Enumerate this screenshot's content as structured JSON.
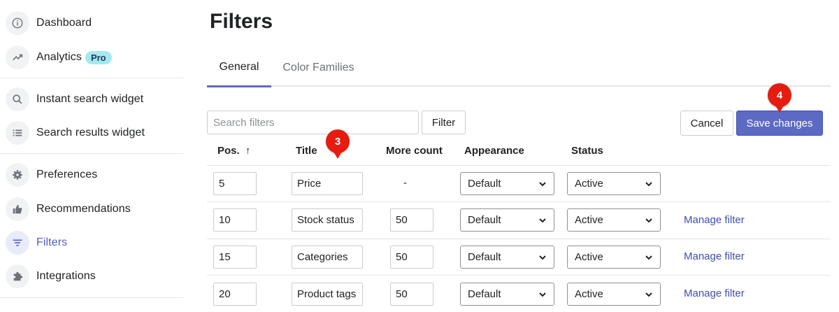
{
  "sidebar": {
    "items": [
      {
        "label": "Dashboard",
        "icon": "info-icon"
      },
      {
        "label": "Analytics",
        "icon": "trend-icon",
        "badge": "Pro"
      },
      {
        "label": "Instant search widget",
        "icon": "search-icon"
      },
      {
        "label": "Search results widget",
        "icon": "list-icon"
      },
      {
        "label": "Preferences",
        "icon": "gear-icon"
      },
      {
        "label": "Recommendations",
        "icon": "thumbs-up-icon"
      },
      {
        "label": "Filters",
        "icon": "filter-icon",
        "active": true
      },
      {
        "label": "Integrations",
        "icon": "puzzle-icon"
      }
    ]
  },
  "page": {
    "title": "Filters",
    "tabs": [
      {
        "label": "General",
        "active": true
      },
      {
        "label": "Color Families",
        "active": false
      }
    ]
  },
  "toolbar": {
    "search_placeholder": "Search filters",
    "filter_label": "Filter",
    "cancel_label": "Cancel",
    "save_label": "Save changes"
  },
  "markers": {
    "title_marker": "3",
    "save_marker": "4"
  },
  "table": {
    "headers": {
      "pos": "Pos.",
      "pos_sort": "↑",
      "title": "Title",
      "more_count": "More count",
      "appearance": "Appearance",
      "status": "Status"
    },
    "rows": [
      {
        "pos": "5",
        "title": "Price",
        "more_count": "-",
        "appearance": "Default",
        "status": "Active",
        "action": ""
      },
      {
        "pos": "10",
        "title": "Stock status",
        "more_count": "50",
        "appearance": "Default",
        "status": "Active",
        "action": "Manage filter"
      },
      {
        "pos": "15",
        "title": "Categories",
        "more_count": "50",
        "appearance": "Default",
        "status": "Active",
        "action": "Manage filter"
      },
      {
        "pos": "20",
        "title": "Product tags",
        "more_count": "50",
        "appearance": "Default",
        "status": "Active",
        "action": "Manage filter"
      }
    ]
  },
  "colors": {
    "accent": "#5c6ac4",
    "link": "#3f4eae",
    "marker": "#e51c0f",
    "pro_badge": "#a4e8f2"
  }
}
